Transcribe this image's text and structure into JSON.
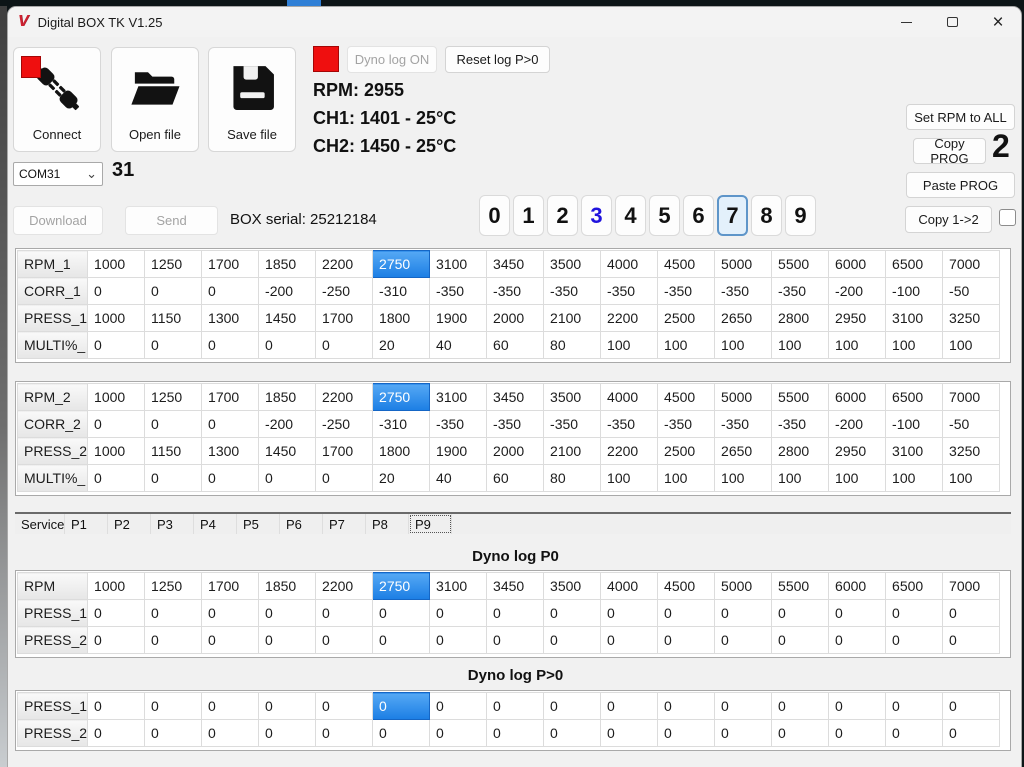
{
  "window": {
    "title": "Digital BOX TK V1.25",
    "app_icon_glyph": "V"
  },
  "toolbar": {
    "connect_label": "Connect",
    "open_label": "Open file",
    "save_label": "Save file"
  },
  "status": {
    "dyno_log_label": "Dyno log ON",
    "reset_log_label": "Reset log P>0",
    "rpm_text": "RPM: 2955",
    "ch1_text": "CH1: 1401 - 25°C",
    "ch2_text": "CH2: 1450 - 25°C"
  },
  "comm": {
    "port": "COM31",
    "port_number": "31",
    "download_label": "Download",
    "send_label": "Send",
    "box_serial_text": "BOX serial: 25212184"
  },
  "right_panel": {
    "set_rpm_label": "Set RPM to ALL",
    "copy_prog_label": "Copy PROG",
    "copy_prog_value": "2",
    "paste_prog_label": "Paste PROG",
    "copy_12_label": "Copy 1->2"
  },
  "digit_buttons": {
    "digits": [
      0,
      1,
      2,
      3,
      4,
      5,
      6,
      7,
      8,
      9
    ],
    "accent_digit": 3,
    "selected_digit": 7
  },
  "tabs": {
    "items": [
      "Service",
      "P1",
      "P2",
      "P3",
      "P4",
      "P5",
      "P6",
      "P7",
      "P8",
      "P9"
    ],
    "selected": "P9"
  },
  "dyno": {
    "p0_title": "Dyno log  P0",
    "pgt0_title": "Dyno log  P>0"
  },
  "tables": {
    "prog1": {
      "rows": [
        {
          "label": "RPM_1",
          "selected": 5,
          "values": [
            1000,
            1250,
            1700,
            1850,
            2200,
            2750,
            3100,
            3450,
            3500,
            4000,
            4500,
            5000,
            5500,
            6000,
            6500,
            7000
          ]
        },
        {
          "label": "CORR_1",
          "values": [
            0,
            0,
            0,
            -200,
            -250,
            -310,
            -350,
            -350,
            -350,
            -350,
            -350,
            -350,
            -350,
            -200,
            -100,
            -50
          ]
        },
        {
          "label": "PRESS_1",
          "values": [
            1000,
            1150,
            1300,
            1450,
            1700,
            1800,
            1900,
            2000,
            2100,
            2200,
            2500,
            2650,
            2800,
            2950,
            3100,
            3250
          ]
        },
        {
          "label": "MULTI%_",
          "values": [
            0,
            0,
            0,
            0,
            0,
            20,
            40,
            60,
            80,
            100,
            100,
            100,
            100,
            100,
            100,
            100
          ]
        }
      ]
    },
    "prog2": {
      "rows": [
        {
          "label": "RPM_2",
          "selected": 5,
          "values": [
            1000,
            1250,
            1700,
            1850,
            2200,
            2750,
            3100,
            3450,
            3500,
            4000,
            4500,
            5000,
            5500,
            6000,
            6500,
            7000
          ]
        },
        {
          "label": "CORR_2",
          "values": [
            0,
            0,
            0,
            -200,
            -250,
            -310,
            -350,
            -350,
            -350,
            -350,
            -350,
            -350,
            -350,
            -200,
            -100,
            -50
          ]
        },
        {
          "label": "PRESS_2",
          "values": [
            1000,
            1150,
            1300,
            1450,
            1700,
            1800,
            1900,
            2000,
            2100,
            2200,
            2500,
            2650,
            2800,
            2950,
            3100,
            3250
          ]
        },
        {
          "label": "MULTI%_",
          "values": [
            0,
            0,
            0,
            0,
            0,
            20,
            40,
            60,
            80,
            100,
            100,
            100,
            100,
            100,
            100,
            100
          ]
        }
      ]
    },
    "dyno_p0": {
      "rows": [
        {
          "label": "RPM",
          "selected": 5,
          "values": [
            1000,
            1250,
            1700,
            1850,
            2200,
            2750,
            3100,
            3450,
            3500,
            4000,
            4500,
            5000,
            5500,
            6000,
            6500,
            7000
          ]
        },
        {
          "label": "PRESS_1",
          "values": [
            0,
            0,
            0,
            0,
            0,
            0,
            0,
            0,
            0,
            0,
            0,
            0,
            0,
            0,
            0,
            0
          ]
        },
        {
          "label": "PRESS_2",
          "values": [
            0,
            0,
            0,
            0,
            0,
            0,
            0,
            0,
            0,
            0,
            0,
            0,
            0,
            0,
            0,
            0
          ]
        }
      ]
    },
    "dyno_pgt0": {
      "rows": [
        {
          "label": "PRESS_1",
          "selected": 5,
          "values": [
            0,
            0,
            0,
            0,
            0,
            0,
            0,
            0,
            0,
            0,
            0,
            0,
            0,
            0,
            0,
            0
          ]
        },
        {
          "label": "PRESS_2",
          "values": [
            0,
            0,
            0,
            0,
            0,
            0,
            0,
            0,
            0,
            0,
            0,
            0,
            0,
            0,
            0,
            0
          ]
        }
      ]
    }
  },
  "colors": {
    "selection_blue": "#1c7ee4",
    "accent_digit_blue": "#2013dd",
    "indicator_red": "#ef0f0f"
  }
}
